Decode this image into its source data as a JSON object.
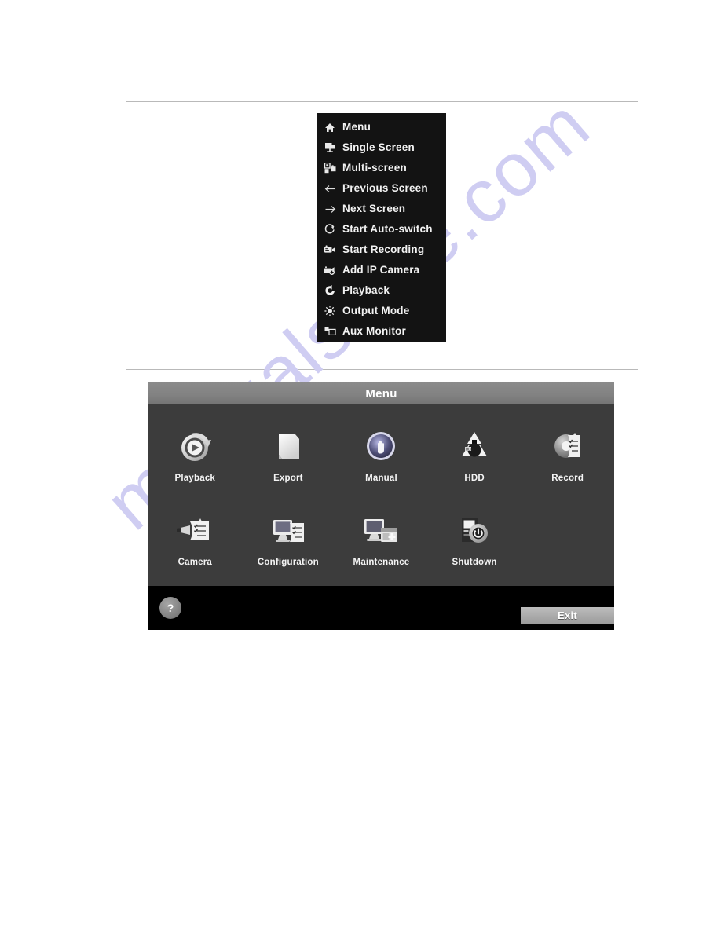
{
  "page": {
    "watermark": "manualshive.com",
    "watermark_color": "#cfcdf2",
    "background": "#ffffff"
  },
  "context_menu": {
    "name": "right-click-context-menu",
    "background": "#131313",
    "text_color": "#f2f2f2",
    "items": [
      {
        "label": "Menu",
        "icon": "home-icon"
      },
      {
        "label": "Single Screen",
        "icon": "single-screen-icon"
      },
      {
        "label": "Multi-screen",
        "icon": "multi-screen-icon"
      },
      {
        "label": "Previous Screen",
        "icon": "arrow-left-icon"
      },
      {
        "label": "Next Screen",
        "icon": "arrow-right-icon"
      },
      {
        "label": "Start Auto-switch",
        "icon": "refresh-circle-icon"
      },
      {
        "label": "Start Recording",
        "icon": "video-camera-icon"
      },
      {
        "label": "Add IP Camera",
        "icon": "add-camera-icon"
      },
      {
        "label": "Playback",
        "icon": "playback-arrow-icon"
      },
      {
        "label": "Output Mode",
        "icon": "brightness-icon"
      },
      {
        "label": "Aux Monitor",
        "icon": "aux-monitor-icon"
      }
    ]
  },
  "dvr_menu": {
    "title": "Menu",
    "title_bar_color": "#828282",
    "body_color": "#3c3c3c",
    "footer_color": "#000000",
    "row1": [
      {
        "label": "Playback",
        "icon": "playback-disc-icon"
      },
      {
        "label": "Export",
        "icon": "export-document-icon"
      },
      {
        "label": "Manual",
        "icon": "manual-hand-icon"
      },
      {
        "label": "HDD",
        "icon": "hdd-icon"
      },
      {
        "label": "Record",
        "icon": "record-schedule-icon"
      }
    ],
    "row2": [
      {
        "label": "Camera",
        "icon": "camera-icon"
      },
      {
        "label": "Configuration",
        "icon": "configuration-monitor-icon"
      },
      {
        "label": "Maintenance",
        "icon": "maintenance-icon"
      },
      {
        "label": "Shutdown",
        "icon": "shutdown-power-icon"
      }
    ],
    "footer": {
      "help_label": "?",
      "exit_label": "Exit"
    }
  }
}
